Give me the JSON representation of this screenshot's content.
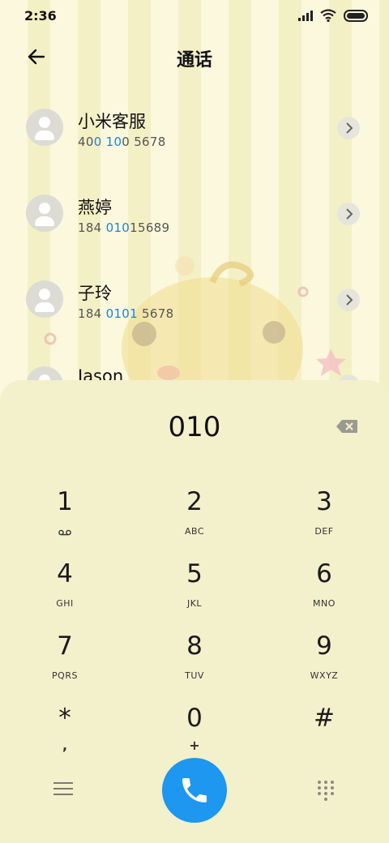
{
  "status_bar": {
    "time": "2:36",
    "icons": [
      "signal-icon",
      "wifi-icon",
      "battery-icon"
    ]
  },
  "header": {
    "back_icon": "arrow-left-icon",
    "title": "通话"
  },
  "contacts": [
    {
      "name": "小米客服",
      "number_parts": [
        "40",
        "0 10",
        "0 5678"
      ]
    },
    {
      "name": "燕婷",
      "number_parts": [
        "184 ",
        "010",
        "15689"
      ]
    },
    {
      "name": "子玲",
      "number_parts": [
        "184 ",
        "0101",
        " 5678"
      ]
    },
    {
      "name": "Jason"
    }
  ],
  "dialpad": {
    "dialed_number": "010",
    "keys": [
      {
        "digit": "1",
        "letters": "",
        "icon": "voicemail-icon"
      },
      {
        "digit": "2",
        "letters": "ABC"
      },
      {
        "digit": "3",
        "letters": "DEF"
      },
      {
        "digit": "4",
        "letters": "GHI"
      },
      {
        "digit": "5",
        "letters": "JKL"
      },
      {
        "digit": "6",
        "letters": "MNO"
      },
      {
        "digit": "7",
        "letters": "PQRS"
      },
      {
        "digit": "8",
        "letters": "TUV"
      },
      {
        "digit": "9",
        "letters": "WXYZ"
      },
      {
        "digit": "*",
        "sub": ","
      },
      {
        "digit": "0",
        "sub": "+"
      },
      {
        "digit": "#",
        "sub": ""
      }
    ],
    "bottom_icons": [
      "menu-icon",
      "phone-icon",
      "dialpad-grid-icon"
    ]
  },
  "colors": {
    "call_button": "#1d97f0",
    "highlight": "#1a86d6",
    "dialpad_bg": "#f3f0cc"
  }
}
